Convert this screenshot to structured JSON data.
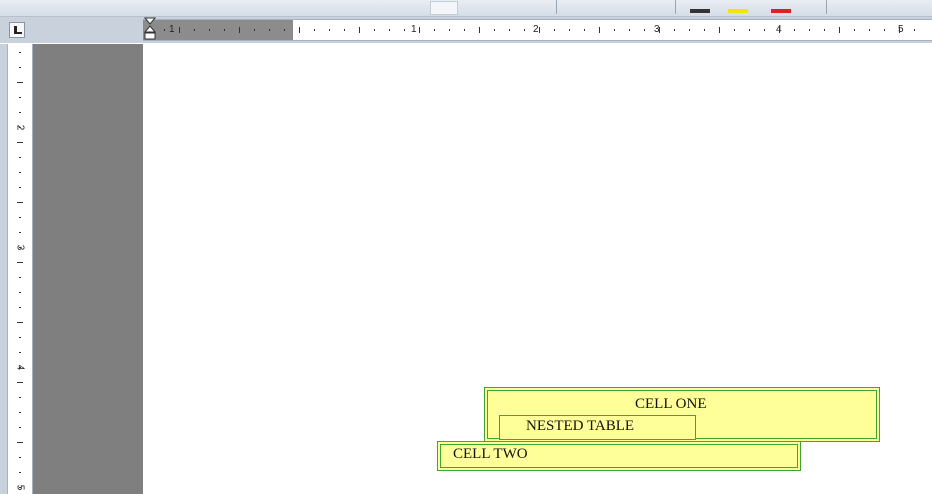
{
  "toolbar": {
    "highlight_color": "#f2e600",
    "font_color": "#e02020"
  },
  "ruler": {
    "tab_selector_icon": "left-tab-icon",
    "horizontal_labels": [
      "1",
      "1",
      "2",
      "3",
      "4",
      "5"
    ],
    "vertical_labels": [
      "2",
      "3",
      "4",
      "5"
    ]
  },
  "document": {
    "cell_one": "CELL ONE",
    "nested_table": "NESTED TABLE",
    "cell_two": "CELL TWO",
    "cell_fill": "#ffff99",
    "cell_border": "#3fa535"
  }
}
